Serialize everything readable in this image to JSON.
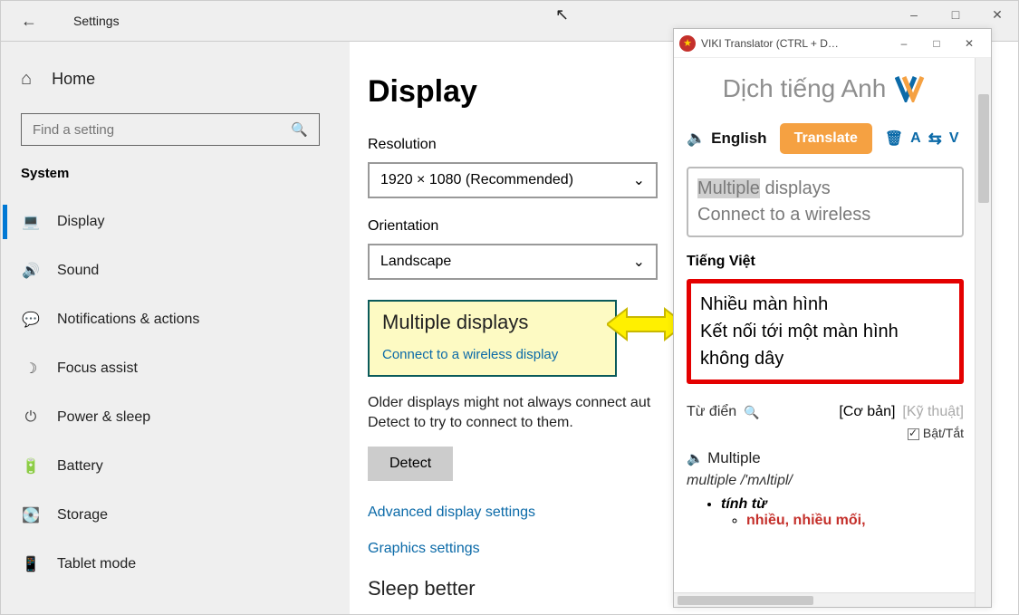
{
  "settings": {
    "titlebar": {
      "title": "Settings"
    },
    "home_label": "Home",
    "search_placeholder": "Find a setting",
    "system_label": "System",
    "nav": [
      {
        "icon": "monitor",
        "label": "Display",
        "active": true
      },
      {
        "icon": "sound",
        "label": "Sound"
      },
      {
        "icon": "notifications",
        "label": "Notifications & actions"
      },
      {
        "icon": "focus",
        "label": "Focus assist"
      },
      {
        "icon": "power",
        "label": "Power & sleep"
      },
      {
        "icon": "battery",
        "label": "Battery"
      },
      {
        "icon": "storage",
        "label": "Storage"
      },
      {
        "icon": "tablet",
        "label": "Tablet mode"
      }
    ],
    "content": {
      "page_title": "Display",
      "resolution_label": "Resolution",
      "resolution_value": "1920 × 1080 (Recommended)",
      "orientation_label": "Orientation",
      "orientation_value": "Landscape",
      "highlight_title": "Multiple displays",
      "highlight_link": "Connect to a wireless display",
      "older_text": "Older displays might not always connect aut|Detect to try to connect to them.",
      "detect_button": "Detect",
      "adv_link": "Advanced display settings",
      "gfx_link": "Graphics settings",
      "sleep_better": "Sleep better"
    }
  },
  "viki": {
    "title": "VIKI Translator (CTRL + D…",
    "heading": "Dịch tiếng Anh",
    "english_label": "English",
    "translate_button": "Translate",
    "tool_a": "A",
    "tool_v": "V",
    "input_highlight": "Multiple",
    "input_rest1": " displays",
    "input_line2": "Connect to a wireless",
    "tv_label": "Tiếng Việt",
    "output_line1": "Nhiều màn hình",
    "output_line2": "Kết nối tới một màn hình không dây",
    "dict_label": "Từ điển",
    "tab_basic": "[Cơ bản]",
    "tab_tech": "[Kỹ thuật]",
    "toggle_label": "Bật/Tắt",
    "dict_word": "Multiple",
    "dict_phon": "multiple /'mʌltipl/",
    "dict_pos": "tính từ",
    "dict_meaning": "nhiều, nhiều mối,"
  }
}
